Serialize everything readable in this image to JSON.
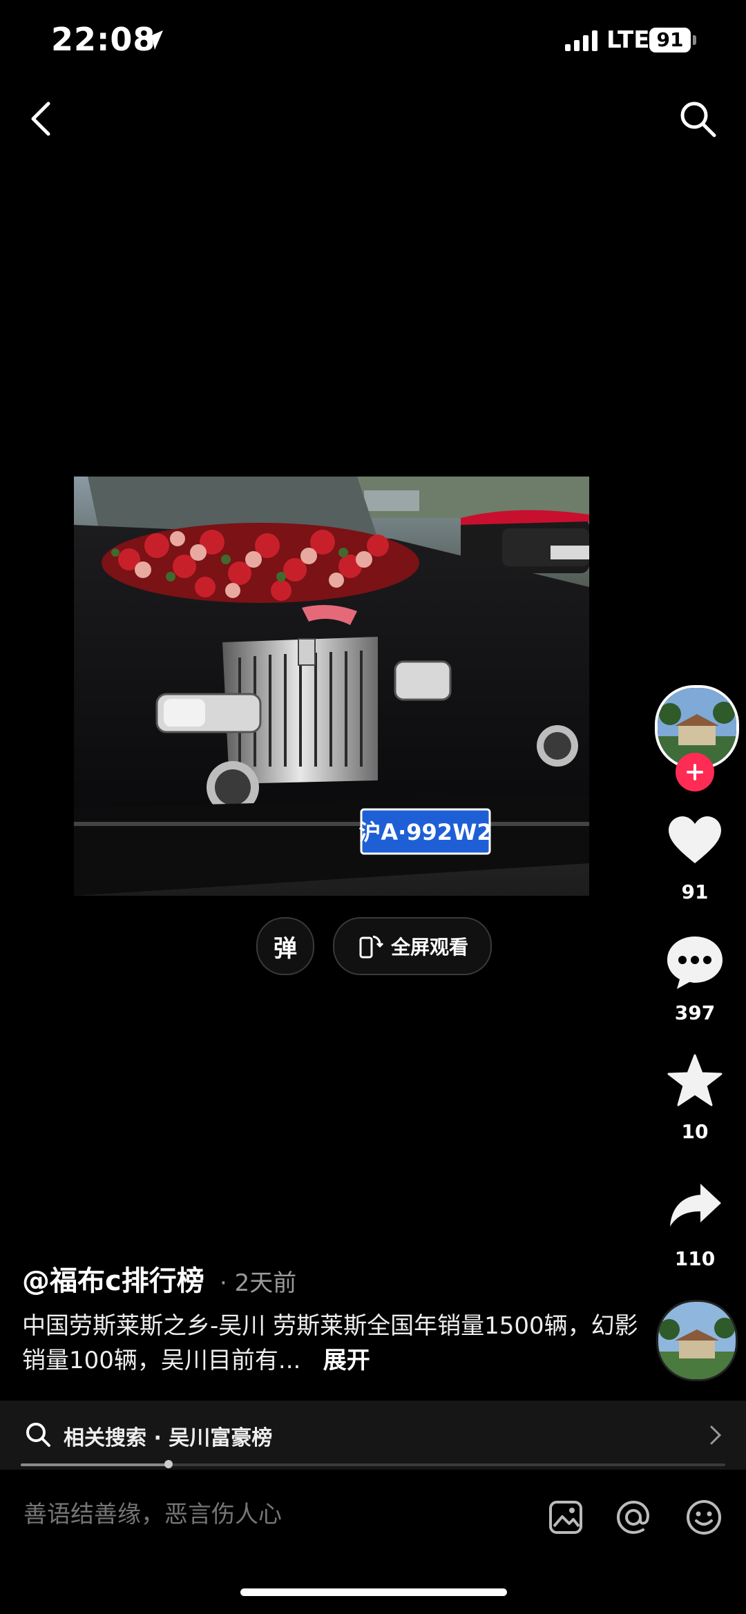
{
  "status_bar": {
    "time": "22:08",
    "network": "LTE",
    "battery": "91"
  },
  "video": {
    "plate_text": "沪A·992W2",
    "danmu_label": "弹",
    "fullscreen_label": "全屏观看"
  },
  "rail": {
    "likes": "91",
    "comments": "397",
    "favorites": "10",
    "shares": "110"
  },
  "caption": {
    "author": "@福布c排行榜",
    "time_ago": "· 2天前",
    "description": "中国劳斯莱斯之乡-吴川 劳斯莱斯全国年销量1500辆，幻影销量100辆，吴川目前有...",
    "expand": "展开"
  },
  "related": {
    "text": "相关搜索 · 吴川富豪榜",
    "progress": 0.21
  },
  "comment_bar": {
    "placeholder": "善语结善缘，恶言伤人心"
  },
  "colors": {
    "accent": "#fe2c55",
    "background": "#000000"
  }
}
